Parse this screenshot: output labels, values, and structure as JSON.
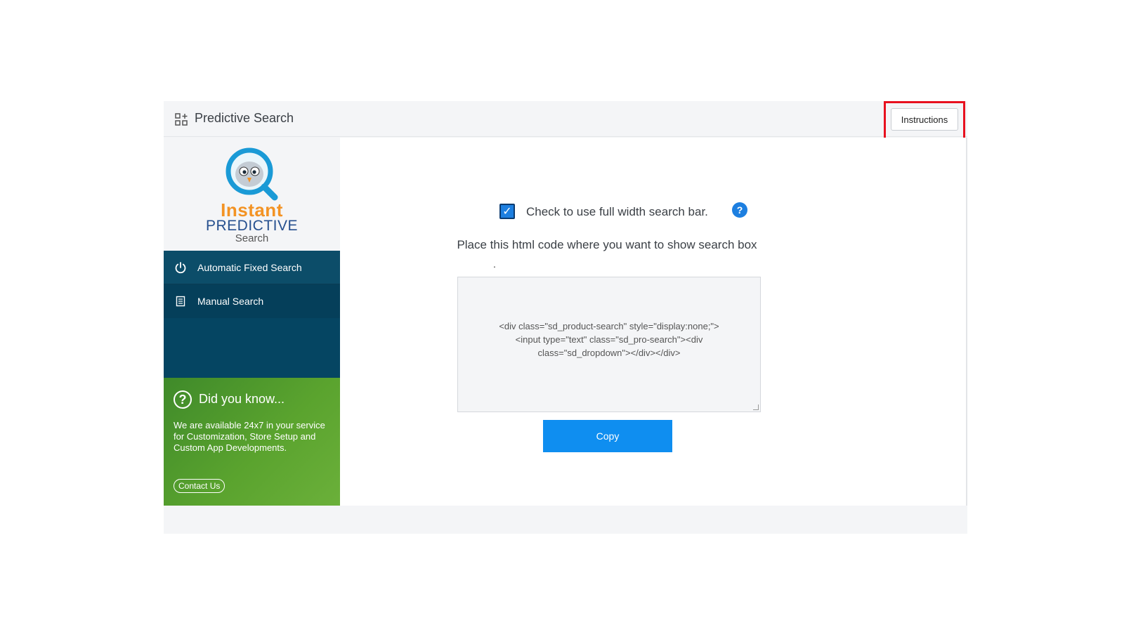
{
  "app": {
    "title": "Predictive Search",
    "instructions_label": "Instructions"
  },
  "logo": {
    "line1": "Instant",
    "line2": "PREDICTIVE",
    "line3": "Search"
  },
  "sidebar": {
    "items": [
      {
        "label": "Automatic Fixed Search",
        "icon": "power-icon"
      },
      {
        "label": "Manual Search",
        "icon": "document-icon"
      }
    ]
  },
  "tip": {
    "title": "Did you know...",
    "text": "We are available 24x7 in your service for Customization, Store Setup and Custom App Developments.",
    "contact_label": "Contact Us"
  },
  "main": {
    "checkbox_label": "Check to use full width search bar.",
    "checkbox_checked": true,
    "help_label": "?",
    "place_text": "Place this html code where you want to show search box",
    "dot": ".",
    "code": "<div class=\"sd_product-search\" style=\"display:none;\"> <input type=\"text\" class=\"sd_pro-search\"><div class=\"sd_dropdown\"></div></div>",
    "copy_label": "Copy"
  },
  "colors": {
    "accent": "#0f8ef0",
    "nav_bg": "#054562",
    "tip_green": "#5aa32e",
    "highlight": "#e8111f"
  }
}
